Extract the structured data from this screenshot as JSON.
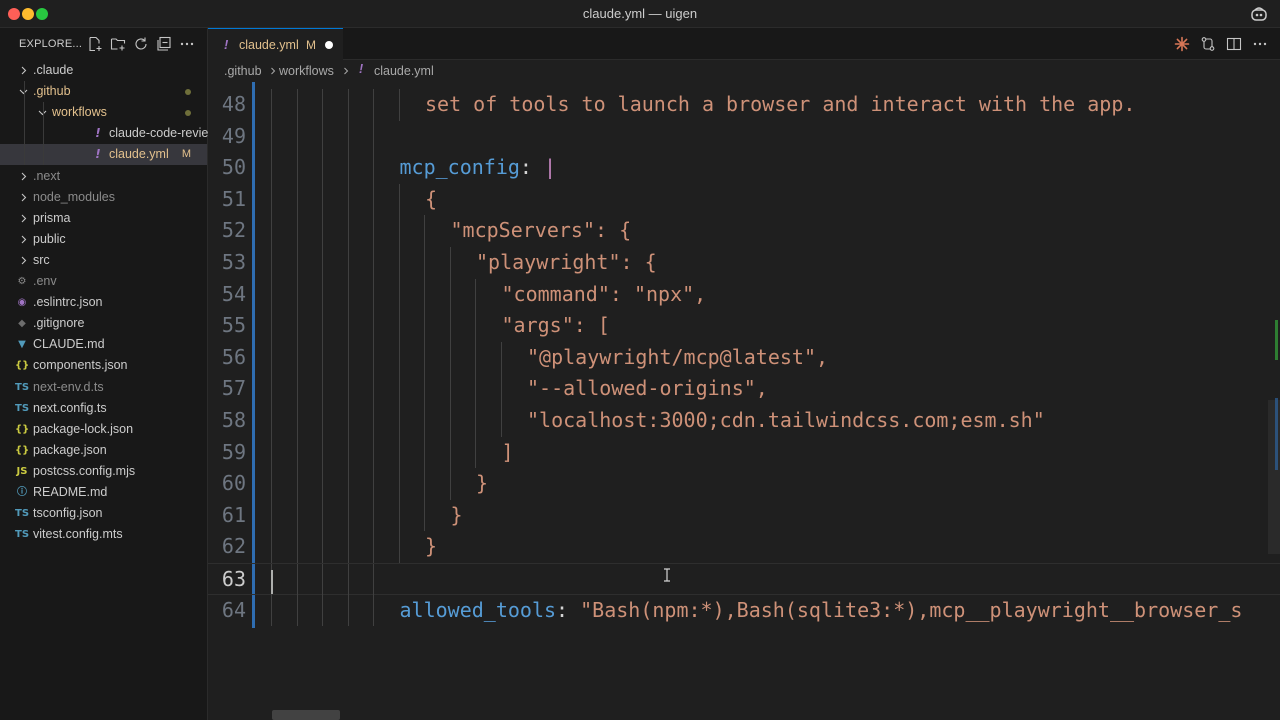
{
  "window": {
    "title": "claude.yml — uigen"
  },
  "explorer": {
    "title": "EXPLORE...",
    "items": [
      {
        "label": ".claude",
        "kind": "folder",
        "expanded": false,
        "color": "#cccccc"
      },
      {
        "label": ".github",
        "kind": "folder",
        "expanded": true,
        "color": "#e2c08d",
        "indicator": "dot"
      },
      {
        "label": "workflows",
        "kind": "folder",
        "expanded": true,
        "color": "#e2c08d",
        "indicator": "dot"
      },
      {
        "label": "claude-code-review.y...",
        "kind": "yaml",
        "color": "#cccccc"
      },
      {
        "label": "claude.yml",
        "kind": "yaml",
        "color": "#e2c08d",
        "badge": "M",
        "selected": true
      },
      {
        "label": ".next",
        "kind": "folder",
        "expanded": false,
        "color": "#8b8b8b"
      },
      {
        "label": "node_modules",
        "kind": "folder",
        "expanded": false,
        "color": "#8b8b8b"
      },
      {
        "label": "prisma",
        "kind": "folder",
        "expanded": false,
        "color": "#cccccc"
      },
      {
        "label": "public",
        "kind": "folder",
        "expanded": false,
        "color": "#cccccc"
      },
      {
        "label": "src",
        "kind": "folder",
        "expanded": false,
        "color": "#cccccc"
      },
      {
        "label": ".env",
        "kind": "gear",
        "color": "#8b8b8b"
      },
      {
        "label": ".eslintrc.json",
        "kind": "eslint",
        "color": "#cccccc"
      },
      {
        "label": ".gitignore",
        "kind": "git",
        "color": "#cccccc"
      },
      {
        "label": "CLAUDE.md",
        "kind": "md-down",
        "color": "#cccccc"
      },
      {
        "label": "components.json",
        "kind": "json",
        "color": "#cccccc"
      },
      {
        "label": "next-env.d.ts",
        "kind": "ts",
        "color": "#8b8b8b"
      },
      {
        "label": "next.config.ts",
        "kind": "ts",
        "color": "#cccccc"
      },
      {
        "label": "package-lock.json",
        "kind": "json",
        "color": "#cccccc"
      },
      {
        "label": "package.json",
        "kind": "json",
        "color": "#cccccc"
      },
      {
        "label": "postcss.config.mjs",
        "kind": "js",
        "color": "#cccccc"
      },
      {
        "label": "README.md",
        "kind": "info",
        "color": "#cccccc"
      },
      {
        "label": "tsconfig.json",
        "kind": "tsconfig",
        "color": "#cccccc"
      },
      {
        "label": "vitest.config.mts",
        "kind": "ts",
        "color": "#cccccc"
      }
    ]
  },
  "tabs": [
    {
      "label": "claude.yml",
      "badge": "M",
      "dirty": true,
      "active": true
    }
  ],
  "breadcrumb": [
    ".github",
    "workflows",
    "claude.yml"
  ],
  "editor": {
    "lines": [
      {
        "n": "48",
        "indent": 6,
        "parts": [
          {
            "t": "set of tools to launch a browser and interact with the app.",
            "c": "s"
          }
        ]
      },
      {
        "n": "49",
        "indent": 0,
        "parts": []
      },
      {
        "n": "50",
        "indent": 5,
        "parts": [
          {
            "t": "mcp_config",
            "c": "k"
          },
          {
            "t": ": ",
            "c": "p"
          },
          {
            "t": "|",
            "c": "pipe"
          }
        ]
      },
      {
        "n": "51",
        "indent": 6,
        "parts": [
          {
            "t": "{",
            "c": "s"
          }
        ]
      },
      {
        "n": "52",
        "indent": 7,
        "parts": [
          {
            "t": "\"mcpServers\": {",
            "c": "s"
          }
        ]
      },
      {
        "n": "53",
        "indent": 8,
        "parts": [
          {
            "t": "\"playwright\": {",
            "c": "s"
          }
        ]
      },
      {
        "n": "54",
        "indent": 9,
        "parts": [
          {
            "t": "\"command\": \"npx\",",
            "c": "s"
          }
        ]
      },
      {
        "n": "55",
        "indent": 9,
        "parts": [
          {
            "t": "\"args\": [",
            "c": "s"
          }
        ]
      },
      {
        "n": "56",
        "indent": 10,
        "parts": [
          {
            "t": "\"@playwright/mcp@latest\",",
            "c": "s"
          }
        ]
      },
      {
        "n": "57",
        "indent": 10,
        "parts": [
          {
            "t": "\"--allowed-origins\",",
            "c": "s"
          }
        ]
      },
      {
        "n": "58",
        "indent": 10,
        "parts": [
          {
            "t": "\"localhost:3000;cdn.tailwindcss.com;esm.sh\"",
            "c": "s"
          }
        ]
      },
      {
        "n": "59",
        "indent": 9,
        "parts": [
          {
            "t": "]",
            "c": "s"
          }
        ]
      },
      {
        "n": "60",
        "indent": 8,
        "parts": [
          {
            "t": "}",
            "c": "s"
          }
        ]
      },
      {
        "n": "61",
        "indent": 7,
        "parts": [
          {
            "t": "}",
            "c": "s"
          }
        ]
      },
      {
        "n": "62",
        "indent": 6,
        "parts": [
          {
            "t": "}",
            "c": "s"
          }
        ]
      },
      {
        "n": "63",
        "indent": 0,
        "parts": [],
        "current": true
      },
      {
        "n": "64",
        "indent": 5,
        "parts": [
          {
            "t": "allowed_tools",
            "c": "k"
          },
          {
            "t": ": ",
            "c": "p"
          },
          {
            "t": "\"Bash(npm:*),Bash(sqlite3:*),mcp__playwright__browser_s",
            "c": "s"
          }
        ]
      }
    ]
  },
  "colors": {
    "accent": "#0078d4",
    "modified": "#e2c08d",
    "string": "#ce9178",
    "key": "#569cd6"
  }
}
